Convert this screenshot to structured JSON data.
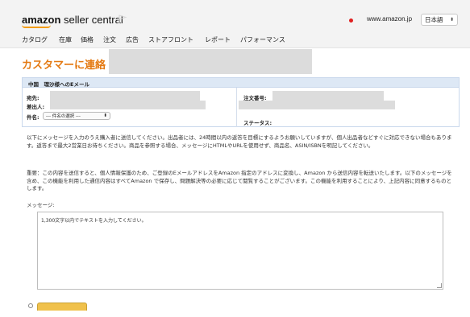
{
  "header": {
    "logo_brand": "amazon",
    "logo_suffix": "seller central",
    "domain": "www.amazon.jp",
    "language": "日本語",
    "accent_color": "#e47911"
  },
  "nav": {
    "items": [
      "カタログ",
      "在庫",
      "価格",
      "注文",
      "広告",
      "ストアフロント",
      "レポート",
      "パフォーマンス"
    ]
  },
  "page": {
    "title": "カスタマーに連絡 >"
  },
  "form": {
    "header": "中国　理沙様へのEメール",
    "to_label": "宛先:",
    "from_label": "差出人:",
    "subject_label": "件名:",
    "subject_select": "--- 件名の選択 ---",
    "order_label": "注文番号:",
    "status_label": "ステータス:"
  },
  "info": {
    "para1": "以下にメッセージを入力のうえ購入者に送信してください。出品者には、24時間以内の返答を目標にするようお願いしていますが、個人出品者などすぐに対応できない場合もあります。返答まで最大2営業日お待ちください。商品を参照する場合、メッセージにHTMLやURLを使用せず、商品名、ASIN/ISBNを明記してください。",
    "para2": "重要：この内容を送信すると、個人情報保護のため、ご登録のEメールアドレスをAmazon 指定のアドレスに変換し、Amazon から送信内容を転送いたします。以下のメッセージを含め、この機能を利用した通信内容はすべてAmazon で保存し、問題解決等の必要に応じて閲覧することがございます。この機能を利用することにより、上記内容に同意するものとします。"
  },
  "message": {
    "label": "メッセージ:",
    "placeholder": "1,300文字以内でテキストを入力してください。"
  }
}
